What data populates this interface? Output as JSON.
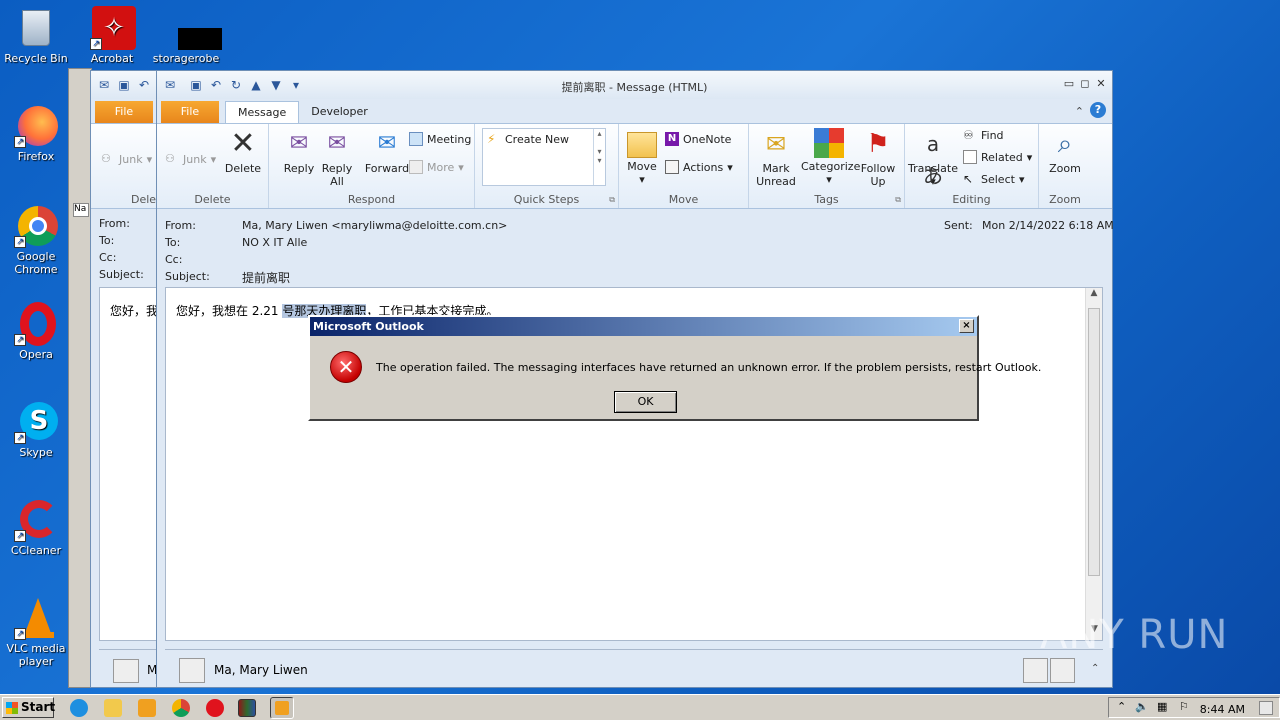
{
  "desktop": {
    "icons": [
      {
        "label": "Recycle Bin",
        "icon": "recycle-bin-icon"
      },
      {
        "label": "Acrobat",
        "icon": "acrobat-icon"
      },
      {
        "label": "storagerobe",
        "icon": "black-file-icon"
      },
      {
        "label": "Firefox",
        "icon": "firefox-icon"
      },
      {
        "label": "Google Chrome",
        "icon": "chrome-icon"
      },
      {
        "label": "Opera",
        "icon": "opera-icon"
      },
      {
        "label": "Skype",
        "icon": "skype-icon"
      },
      {
        "label": "CCleaner",
        "icon": "ccleaner-icon"
      },
      {
        "label": "VLC media player",
        "icon": "vlc-icon"
      }
    ]
  },
  "back_window": {
    "file_tab": "File",
    "tab_letters": "File",
    "group_partial": "Delet",
    "junk": "Junk",
    "from": "From:",
    "to": "To:",
    "cc": "Cc:",
    "subject": "Subject:",
    "body_partial": "您好，我",
    "nav_label": "Na",
    "person_partial": "M"
  },
  "message_window": {
    "title": "提前离职 -  Message (HTML)",
    "tabs": {
      "file": "File",
      "message": "Message",
      "developer": "Developer"
    },
    "ribbon": {
      "junk": "Junk",
      "delete": "Delete",
      "delete_group": "Delete",
      "reply": "Reply",
      "reply_all": "Reply All",
      "forward": "Forward",
      "meeting": "Meeting",
      "more": "More",
      "respond_group": "Respond",
      "create_new": "Create New",
      "quick_steps_group": "Quick Steps",
      "move": "Move",
      "onenote": "OneNote",
      "actions": "Actions",
      "move_group": "Move",
      "mark_unread": "Mark Unread",
      "categorize": "Categorize",
      "follow_up": "Follow Up",
      "tags_group": "Tags",
      "translate": "Translate",
      "find": "Find",
      "related": "Related",
      "select": "Select",
      "editing_group": "Editing",
      "zoom": "Zoom",
      "zoom_group": "Zoom"
    },
    "header": {
      "from_label": "From:",
      "from_value": "Ma, Mary Liwen <maryliwma@deloitte.com.cn>",
      "to_label": "To:",
      "to_value": "NO X IT Alle",
      "cc_label": "Cc:",
      "subject_label": "Subject:",
      "subject_value": "提前离职",
      "sent_label": "Sent:",
      "sent_value": "Mon 2/14/2022 6:18 AM"
    },
    "body": {
      "text_before": "您好，我想在 2.21 ",
      "text_selected": "号那天办理离职",
      "text_after": "，工作已基本交接完成。"
    },
    "people_pane": {
      "name": "Ma, Mary Liwen"
    }
  },
  "dialog": {
    "title": "Microsoft Outlook",
    "message": "The operation failed.  The messaging interfaces have returned an unknown error. If the problem persists, restart Outlook.",
    "ok": "OK",
    "close": "×"
  },
  "taskbar": {
    "start": "Start",
    "clock": "8:44 AM"
  },
  "watermark": "ANY RUN"
}
